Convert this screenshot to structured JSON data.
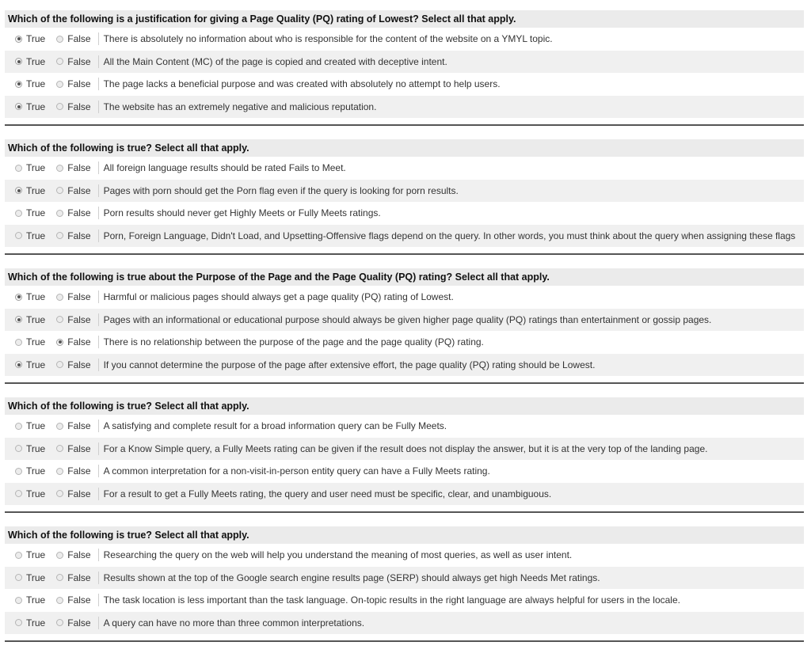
{
  "labels": {
    "true": "True",
    "false": "False"
  },
  "questions": [
    {
      "title": "Which of the following is a justification for giving a Page Quality (PQ) rating of Lowest? Select all that apply.",
      "options": [
        {
          "text": "There is absolutely no information about who is responsible for the content of the website on a YMYL topic.",
          "selected": "true"
        },
        {
          "text": "All the Main Content (MC) of the page is copied and created with deceptive intent.",
          "selected": "true"
        },
        {
          "text": "The page lacks a beneficial purpose and was created with absolutely no attempt to help users.",
          "selected": "true"
        },
        {
          "text": "The website has an extremely negative and malicious reputation.",
          "selected": "true"
        }
      ]
    },
    {
      "title": "Which of the following is true? Select all that apply.",
      "options": [
        {
          "text": "All foreign language results should be rated Fails to Meet.",
          "selected": "none"
        },
        {
          "text": "Pages with porn should get the Porn flag even if the query is looking for porn results.",
          "selected": "true"
        },
        {
          "text": "Porn results should never get Highly Meets or Fully Meets ratings.",
          "selected": "none"
        },
        {
          "text": "Porn, Foreign Language, Didn't Load, and Upsetting-Offensive flags depend on the query. In other words, you must think about the query when assigning these flags",
          "selected": "none"
        }
      ]
    },
    {
      "title": "Which of the following is true about the Purpose of the Page and the Page Quality (PQ) rating? Select all that apply.",
      "options": [
        {
          "text": "Harmful or malicious pages should always get a page quality (PQ) rating of Lowest.",
          "selected": "true"
        },
        {
          "text": "Pages with an informational or educational purpose should always be given higher page quality (PQ) ratings than entertainment or gossip pages.",
          "selected": "true"
        },
        {
          "text": "There is no relationship between the purpose of the page and the page quality (PQ) rating.",
          "selected": "false"
        },
        {
          "text": "If you cannot determine the purpose of the page after extensive effort, the page quality (PQ) rating should be Lowest.",
          "selected": "true"
        }
      ]
    },
    {
      "title": "Which of the following is true? Select all that apply.",
      "options": [
        {
          "text": "A satisfying and complete result for a broad information query can be Fully Meets.",
          "selected": "none"
        },
        {
          "text": "For a Know Simple query, a Fully Meets rating can be given if the result does not display the answer, but it is at the very top of the landing page.",
          "selected": "none"
        },
        {
          "text": "A common interpretation for a non-visit-in-person entity query can have a Fully Meets rating.",
          "selected": "none"
        },
        {
          "text": "For a result to get a Fully Meets rating, the query and user need must be specific, clear, and unambiguous.",
          "selected": "none"
        }
      ]
    },
    {
      "title": "Which of the following is true? Select all that apply.",
      "options": [
        {
          "text": "Researching the query on the web will help you understand the meaning of most queries, as well as user intent.",
          "selected": "none"
        },
        {
          "text": "Results shown at the top of the Google search engine results page (SERP) should always get high Needs Met ratings.",
          "selected": "none"
        },
        {
          "text": "The task location is less important than the task language. On-topic results in the right language are always helpful for users in the locale.",
          "selected": "none"
        },
        {
          "text": "A query can have no more than three common interpretations.",
          "selected": "none"
        }
      ]
    }
  ]
}
